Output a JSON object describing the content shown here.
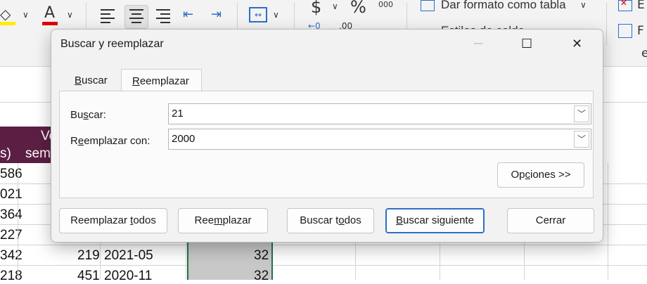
{
  "ribbon": {
    "font_color_glyph": "A",
    "dollar_glyph": "$",
    "percent_glyph": "%",
    "comma_glyph": "000",
    "dec_inc_glyph": "←0",
    "dec_dec_glyph": ",00",
    "format_table_label": "Dar formato como tabla",
    "cell_styles_label": "Estilos de celda",
    "right_label_1": "E",
    "right_label_2": "F",
    "right_label_3": "e",
    "colors": {
      "highlight": "#ffee00",
      "font_color": "#e00000"
    }
  },
  "sheet": {
    "header_col_a": "s)",
    "header_col_b_line1": "Ve",
    "header_col_b_line2": "sem",
    "col_a": [
      "586",
      "021",
      "364",
      "227",
      "342",
      "218"
    ],
    "row5": {
      "b": "219",
      "c": "2021-05",
      "d": "32"
    },
    "row6": {
      "b": "451",
      "c": "2020-11",
      "d": "32"
    }
  },
  "dialog": {
    "title": "Buscar y reemplazar",
    "minimize_glyph": "—",
    "maximize_glyph": "☐",
    "close_glyph": "✕",
    "tabs": [
      {
        "pre": "",
        "ul": "B",
        "post": "uscar"
      },
      {
        "pre": "",
        "ul": "R",
        "post": "eemplazar"
      }
    ],
    "find": {
      "pre": "Bu",
      "ul": "s",
      "post": "car:",
      "value": "21"
    },
    "replace": {
      "pre": "R",
      "ul": "e",
      "post": "emplazar con:",
      "value": "2000"
    },
    "dropdown_glyph": "﹀",
    "options_button": {
      "pre": "Op",
      "ul": "c",
      "post": "iones >>"
    },
    "buttons": {
      "replace_all": {
        "pre": "Reemplazar ",
        "ul": "t",
        "post": "odos"
      },
      "replace": {
        "pre": "Ree",
        "ul": "m",
        "post": "plazar"
      },
      "find_all": {
        "pre": "Buscar t",
        "ul": "o",
        "post": "dos"
      },
      "find_next": {
        "pre": "",
        "ul": "B",
        "post": "uscar siguiente"
      },
      "close": {
        "label": "Cerrar"
      }
    },
    "accent_color": "#2b6fc7"
  }
}
